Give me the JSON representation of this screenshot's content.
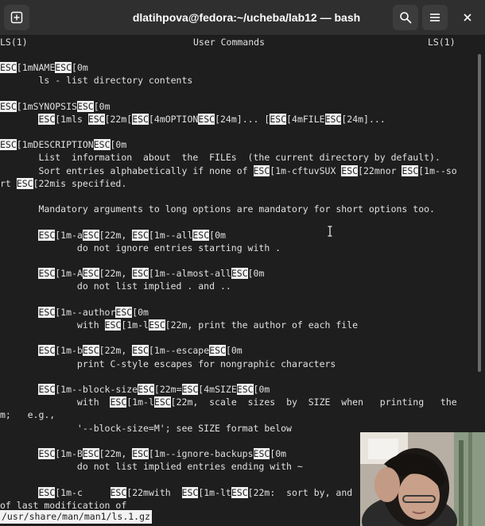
{
  "window": {
    "title": "dlatihpova@fedora:~/ucheba/lab12 — bash"
  },
  "icons": {
    "new_tab": "new-tab-icon",
    "search": "search-icon",
    "menu": "hamburger-menu-icon",
    "close": "close-icon"
  },
  "man": {
    "header_left": "LS(1)",
    "header_center": "User Commands",
    "header_right": "LS(1)",
    "lines": [
      [
        {
          "t": "ESC",
          "e": true
        },
        {
          "t": "[1mNAME"
        },
        {
          "t": "ESC",
          "e": true
        },
        {
          "t": "[0m"
        }
      ],
      [
        {
          "t": "       ls - list directory contents"
        }
      ],
      [],
      [
        {
          "t": "ESC",
          "e": true
        },
        {
          "t": "[1mSYNOPSIS"
        },
        {
          "t": "ESC",
          "e": true
        },
        {
          "t": "[0m"
        }
      ],
      [
        {
          "t": "       "
        },
        {
          "t": "ESC",
          "e": true
        },
        {
          "t": "[1mls "
        },
        {
          "t": "ESC",
          "e": true
        },
        {
          "t": "[22m["
        },
        {
          "t": "ESC",
          "e": true
        },
        {
          "t": "[4mOPTION"
        },
        {
          "t": "ESC",
          "e": true
        },
        {
          "t": "[24m]... ["
        },
        {
          "t": "ESC",
          "e": true
        },
        {
          "t": "[4mFILE"
        },
        {
          "t": "ESC",
          "e": true
        },
        {
          "t": "[24m]..."
        }
      ],
      [],
      [
        {
          "t": "ESC",
          "e": true
        },
        {
          "t": "[1mDESCRIPTION"
        },
        {
          "t": "ESC",
          "e": true
        },
        {
          "t": "[0m"
        }
      ],
      [
        {
          "t": "       List  information  about  the  FILEs  (the current directory by default)."
        }
      ],
      [
        {
          "t": "       Sort entries alphabetically if none of "
        },
        {
          "t": "ESC",
          "e": true
        },
        {
          "t": "[1m-cftuvSUX "
        },
        {
          "t": "ESC",
          "e": true
        },
        {
          "t": "[22mnor "
        },
        {
          "t": "ESC",
          "e": true
        },
        {
          "t": "[1m--so"
        }
      ],
      [
        {
          "t": "rt "
        },
        {
          "t": "ESC",
          "e": true
        },
        {
          "t": "[22mis specified."
        }
      ],
      [],
      [
        {
          "t": "       Mandatory arguments to long options are mandatory for short options too."
        }
      ],
      [],
      [
        {
          "t": "       "
        },
        {
          "t": "ESC",
          "e": true
        },
        {
          "t": "[1m-a"
        },
        {
          "t": "ESC",
          "e": true
        },
        {
          "t": "[22m, "
        },
        {
          "t": "ESC",
          "e": true
        },
        {
          "t": "[1m--all"
        },
        {
          "t": "ESC",
          "e": true
        },
        {
          "t": "[0m"
        }
      ],
      [
        {
          "t": "              do not ignore entries starting with ."
        }
      ],
      [],
      [
        {
          "t": "       "
        },
        {
          "t": "ESC",
          "e": true
        },
        {
          "t": "[1m-A"
        },
        {
          "t": "ESC",
          "e": true
        },
        {
          "t": "[22m, "
        },
        {
          "t": "ESC",
          "e": true
        },
        {
          "t": "[1m--almost-all"
        },
        {
          "t": "ESC",
          "e": true
        },
        {
          "t": "[0m"
        }
      ],
      [
        {
          "t": "              do not list implied . and .."
        }
      ],
      [],
      [
        {
          "t": "       "
        },
        {
          "t": "ESC",
          "e": true
        },
        {
          "t": "[1m--author"
        },
        {
          "t": "ESC",
          "e": true
        },
        {
          "t": "[0m"
        }
      ],
      [
        {
          "t": "              with "
        },
        {
          "t": "ESC",
          "e": true
        },
        {
          "t": "[1m-l"
        },
        {
          "t": "ESC",
          "e": true
        },
        {
          "t": "[22m, print the author of each file"
        }
      ],
      [],
      [
        {
          "t": "       "
        },
        {
          "t": "ESC",
          "e": true
        },
        {
          "t": "[1m-b"
        },
        {
          "t": "ESC",
          "e": true
        },
        {
          "t": "[22m, "
        },
        {
          "t": "ESC",
          "e": true
        },
        {
          "t": "[1m--escape"
        },
        {
          "t": "ESC",
          "e": true
        },
        {
          "t": "[0m"
        }
      ],
      [
        {
          "t": "              print C-style escapes for nongraphic characters"
        }
      ],
      [],
      [
        {
          "t": "       "
        },
        {
          "t": "ESC",
          "e": true
        },
        {
          "t": "[1m--block-size"
        },
        {
          "t": "ESC",
          "e": true
        },
        {
          "t": "[22m="
        },
        {
          "t": "ESC",
          "e": true
        },
        {
          "t": "[4mSIZE"
        },
        {
          "t": "ESC",
          "e": true
        },
        {
          "t": "[0m"
        }
      ],
      [
        {
          "t": "              with  "
        },
        {
          "t": "ESC",
          "e": true
        },
        {
          "t": "[1m-l"
        },
        {
          "t": "ESC",
          "e": true
        },
        {
          "t": "[22m,  scale  sizes  by  SIZE  when   printing   the"
        }
      ],
      [
        {
          "t": "m;   e.g.,"
        }
      ],
      [
        {
          "t": "              '--block-size=M'; see SIZE format below"
        }
      ],
      [],
      [
        {
          "t": "       "
        },
        {
          "t": "ESC",
          "e": true
        },
        {
          "t": "[1m-B"
        },
        {
          "t": "ESC",
          "e": true
        },
        {
          "t": "[22m, "
        },
        {
          "t": "ESC",
          "e": true
        },
        {
          "t": "[1m--ignore-backups"
        },
        {
          "t": "ESC",
          "e": true
        },
        {
          "t": "[0m"
        }
      ],
      [
        {
          "t": "              do not list implied entries ending with ~"
        }
      ],
      [],
      [
        {
          "t": "       "
        },
        {
          "t": "ESC",
          "e": true
        },
        {
          "t": "[1m-c     "
        },
        {
          "t": "ESC",
          "e": true
        },
        {
          "t": "[22mwith  "
        },
        {
          "t": "ESC",
          "e": true
        },
        {
          "t": "[1m-lt"
        },
        {
          "t": "ESC",
          "e": true
        },
        {
          "t": "[22m:  sort by, and"
        }
      ],
      [
        {
          "t": "of last modification of"
        }
      ]
    ]
  },
  "status_line": "/usr/share/man/man1/ls.1.gz"
}
